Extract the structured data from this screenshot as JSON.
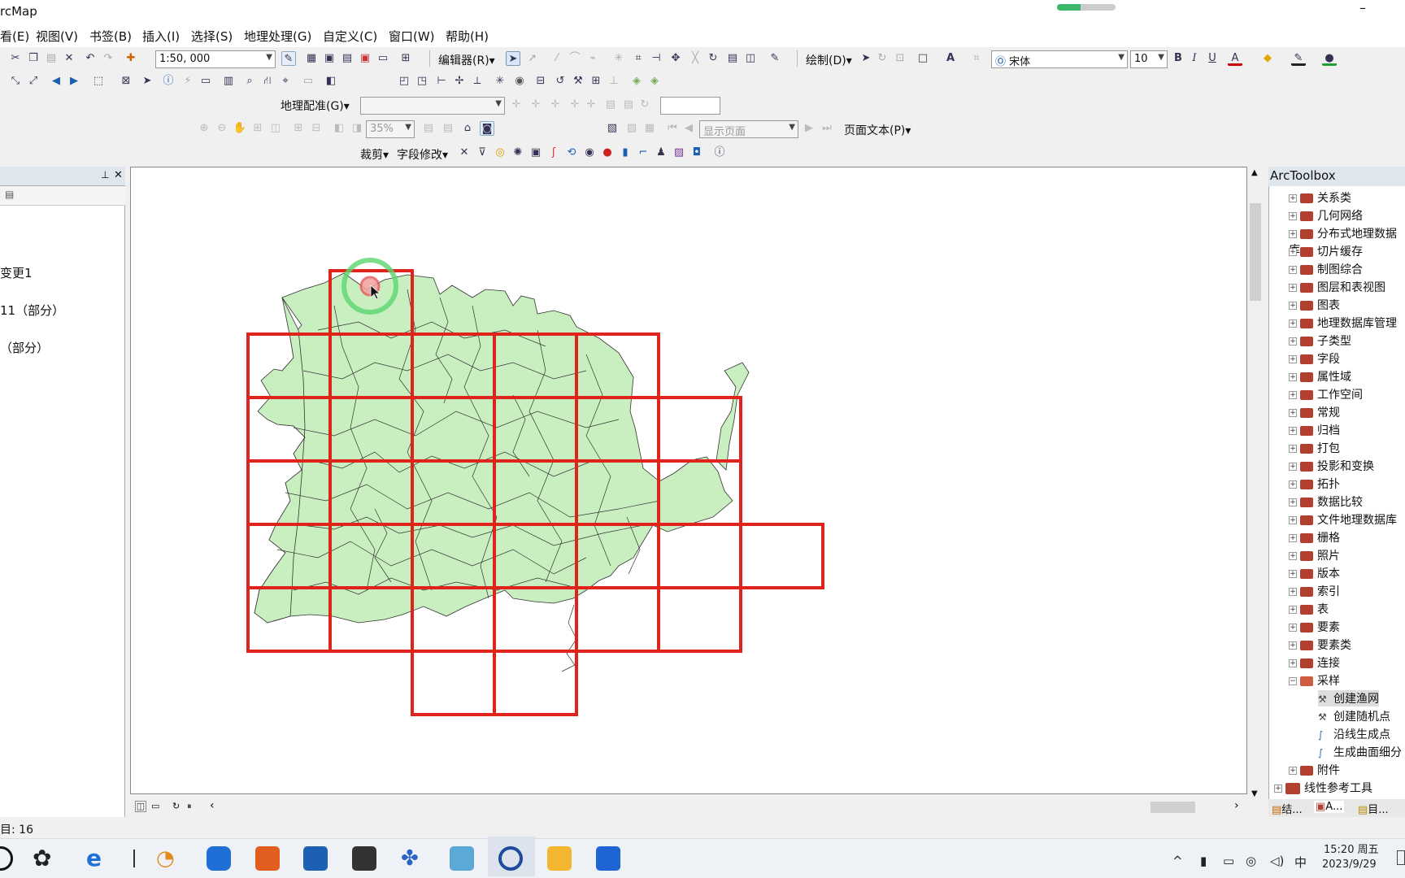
{
  "app": {
    "title": "rcMap"
  },
  "titlebar": {
    "progress": 0.4,
    "minimize_glyph": "–"
  },
  "menu": [
    {
      "label": "看(E)"
    },
    {
      "label": "视图(V)"
    },
    {
      "label": "书签(B)"
    },
    {
      "label": "插入(I)"
    },
    {
      "label": "选择(S)"
    },
    {
      "label": "地理处理(G)"
    },
    {
      "label": "自定义(C)"
    },
    {
      "label": "窗口(W)"
    },
    {
      "label": "帮助(H)"
    }
  ],
  "toolbar": {
    "scale_value": "1:50, 000",
    "editor_label": "编辑器(R)▾",
    "draw_label": "绘制(D)▾",
    "font_name": "宋体",
    "font_size": "10",
    "georef_label": "地理配准(G)▾",
    "zoom_percent": "35%",
    "page_display": "显示页面",
    "page_text_label": "页面文本(P)▾",
    "clip_label": "裁剪▾",
    "field_edit_label": "字段修改▾"
  },
  "toc": {
    "entries": [
      {
        "label": "变更1"
      },
      {
        "label": "11（部分）"
      },
      {
        "label": "（部分）"
      }
    ]
  },
  "map": {
    "land_color": "#c9efc0",
    "grid_color": "#e0241b",
    "outline_color": "#333333"
  },
  "toolbox": {
    "title": "ArcToolbox",
    "items": [
      {
        "label": "关系类",
        "expanded": false
      },
      {
        "label": "几何网络",
        "expanded": false
      },
      {
        "label": "分布式地理数据库",
        "expanded": false
      },
      {
        "label": "切片缓存",
        "expanded": false
      },
      {
        "label": "制图综合",
        "expanded": false
      },
      {
        "label": "图层和表视图",
        "expanded": false
      },
      {
        "label": "图表",
        "expanded": false
      },
      {
        "label": "地理数据库管理",
        "expanded": false
      },
      {
        "label": "子类型",
        "expanded": false
      },
      {
        "label": "字段",
        "expanded": false
      },
      {
        "label": "属性域",
        "expanded": false
      },
      {
        "label": "工作空间",
        "expanded": false
      },
      {
        "label": "常规",
        "expanded": false
      },
      {
        "label": "归档",
        "expanded": false
      },
      {
        "label": "打包",
        "expanded": false
      },
      {
        "label": "投影和变换",
        "expanded": false
      },
      {
        "label": "拓扑",
        "expanded": false
      },
      {
        "label": "数据比较",
        "expanded": false
      },
      {
        "label": "文件地理数据库",
        "expanded": false
      },
      {
        "label": "栅格",
        "expanded": false
      },
      {
        "label": "照片",
        "expanded": false
      },
      {
        "label": "版本",
        "expanded": false
      },
      {
        "label": "索引",
        "expanded": false
      },
      {
        "label": "表",
        "expanded": false
      },
      {
        "label": "要素",
        "expanded": false
      },
      {
        "label": "要素类",
        "expanded": false
      },
      {
        "label": "连接",
        "expanded": false
      },
      {
        "label": "采样",
        "expanded": true
      }
    ],
    "sampling_tools": [
      {
        "label": "创建渔网"
      },
      {
        "label": "创建随机点"
      },
      {
        "label": "沿线生成点"
      },
      {
        "label": "生成曲面细分"
      }
    ],
    "after": {
      "label": "附件"
    },
    "top_level": {
      "label": "线性参考工具"
    },
    "tabs": [
      {
        "label": "结..."
      },
      {
        "label": "A..."
      },
      {
        "label": "目..."
      }
    ]
  },
  "status": {
    "text": "目: 16"
  },
  "tray": {
    "time": "15:20 周五",
    "date": "2023/9/29",
    "ime": "中"
  }
}
